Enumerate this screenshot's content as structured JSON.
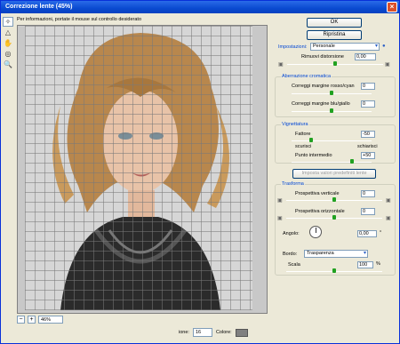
{
  "window": {
    "title": "Correzione lente (45%)",
    "close": "×"
  },
  "tools": [
    "✧",
    "△",
    "✋",
    "◎",
    "🔍"
  ],
  "info": "Per informazioni, portate il mouse sul controllo desiderato",
  "zoom": {
    "minus": "−",
    "plus": "+",
    "value": "46%"
  },
  "bottom": {
    "grid_label": "ione:",
    "grid_value": "16",
    "color_label": "Colore:",
    "color_hex": "#808080"
  },
  "buttons": {
    "ok": "OK",
    "reset": "Ripristina"
  },
  "settings": {
    "label": "Impostazioni:",
    "value": "Personale"
  },
  "distortion": {
    "label": "Rimuovi distorsione",
    "value": "0,00",
    "level": 0.5
  },
  "chromatic": {
    "title": "Aberrazione cromatica",
    "red_cyan": {
      "label": "Correggi margine rosso/cyan",
      "value": "0",
      "level": 0.5
    },
    "blue_yellow": {
      "label": "Correggi margine blu/giallo",
      "value": "0",
      "level": 0.5
    }
  },
  "vignette": {
    "title": "Vignettatura",
    "amount": {
      "label": "Fattore",
      "value": "-50",
      "level": 0.25
    },
    "darken": "scurisci",
    "lighten": "schiarisci",
    "midpoint": {
      "label": "Punto intermedio",
      "value": "+50",
      "level": 0.75
    }
  },
  "default_button": "Imposta valori predefiniti lente",
  "transform": {
    "title": "Trasforma",
    "vertical": {
      "label": "Prospettiva verticale",
      "value": "0",
      "level": 0.5
    },
    "horizontal": {
      "label": "Prospettiva orizzontale",
      "value": "0",
      "level": 0.5
    },
    "angle": {
      "label": "Angolo:",
      "value": "0,00",
      "unit": "°"
    },
    "edge": {
      "label": "Bordo:",
      "value": "Trasparenza"
    },
    "scale": {
      "label": "Scala",
      "value": "100",
      "unit": "%",
      "level": 0.5
    }
  }
}
